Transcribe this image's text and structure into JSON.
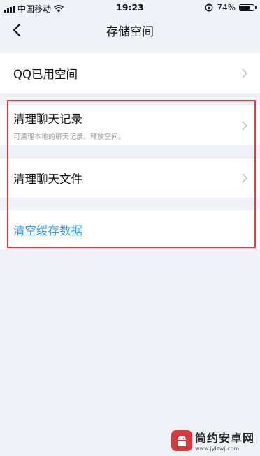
{
  "status_bar": {
    "carrier": "中国移动",
    "time": "19:23",
    "battery_percent": "74%",
    "battery_level": 0.74
  },
  "nav": {
    "title": "存储空间",
    "back_icon": "chevron-left-icon"
  },
  "rows": [
    {
      "title": "QQ已用空间"
    },
    {
      "title": "清理聊天记录",
      "subtitle": "可清理本地的聊天记录，释放空间。"
    },
    {
      "title": "清理聊天文件"
    },
    {
      "title": "清空缓存数据"
    }
  ],
  "colors": {
    "background": "#eef1f6",
    "accent_blue": "#3a9ef0",
    "highlight_red": "#e03a42"
  },
  "watermark": {
    "title": "简约安卓网",
    "url": "www.jylzwj.com"
  }
}
